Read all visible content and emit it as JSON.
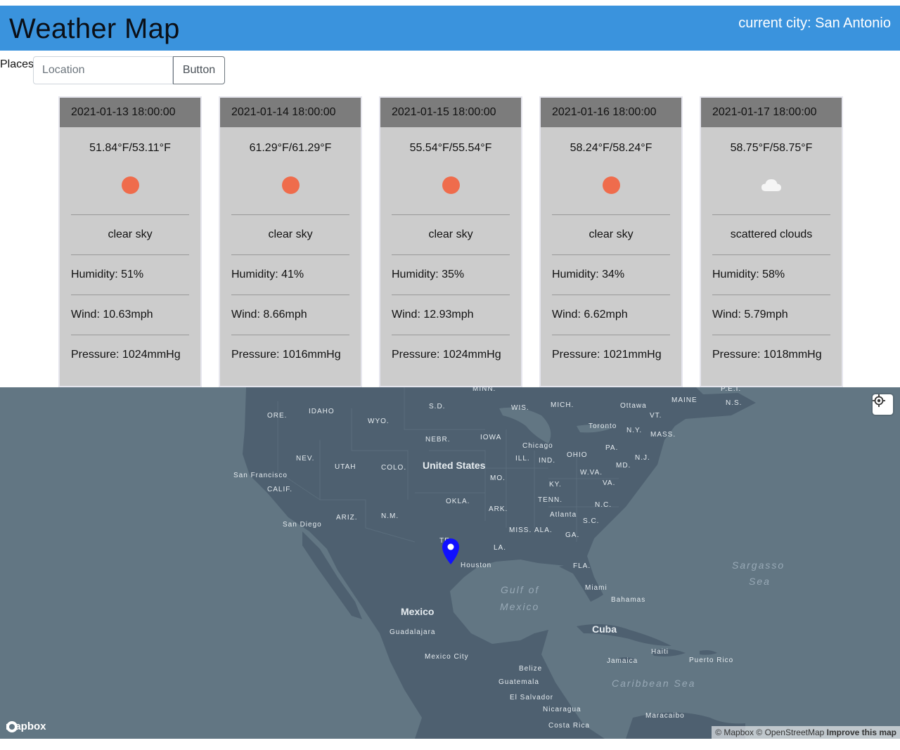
{
  "header": {
    "title": "Weather Map",
    "current_city": "current city: San Antonio"
  },
  "search": {
    "label": "Places",
    "placeholder": "Location",
    "button_label": "Button"
  },
  "forecast": [
    {
      "datetime": "2021-01-13 18:00:00",
      "temps": "51.84°F/53.11°F",
      "icon": "sun-icon",
      "description": "clear sky",
      "humidity": "Humidity: 51%",
      "wind": "Wind: 10.63mph",
      "pressure": "Pressure: 1024mmHg"
    },
    {
      "datetime": "2021-01-14 18:00:00",
      "temps": "61.29°F/61.29°F",
      "icon": "sun-icon",
      "description": "clear sky",
      "humidity": "Humidity: 41%",
      "wind": "Wind: 8.66mph",
      "pressure": "Pressure: 1016mmHg"
    },
    {
      "datetime": "2021-01-15 18:00:00",
      "temps": "55.54°F/55.54°F",
      "icon": "sun-icon",
      "description": "clear sky",
      "humidity": "Humidity: 35%",
      "wind": "Wind: 12.93mph",
      "pressure": "Pressure: 1024mmHg"
    },
    {
      "datetime": "2021-01-16 18:00:00",
      "temps": "58.24°F/58.24°F",
      "icon": "sun-icon",
      "description": "clear sky",
      "humidity": "Humidity: 34%",
      "wind": "Wind: 6.62mph",
      "pressure": "Pressure: 1021mmHg"
    },
    {
      "datetime": "2021-01-17 18:00:00",
      "temps": "58.75°F/58.75°F",
      "icon": "cloud-icon",
      "description": "scattered clouds",
      "humidity": "Humidity: 58%",
      "wind": "Wind: 5.79mph",
      "pressure": "Pressure: 1018mmHg"
    }
  ],
  "map": {
    "labels": {
      "us": "United States",
      "mexico": "Mexico",
      "cuba": "Cuba",
      "gulf": "Gulf of",
      "gulf2": "Mexico",
      "sargasso": "Sargasso",
      "sargasso2": "Sea",
      "caribbean": "Caribbean Sea",
      "houston": "Houston",
      "chicago": "Chicago",
      "atlanta": "Atlanta",
      "miami": "Miami",
      "toronto": "Toronto",
      "ottawa": "Ottawa",
      "sanfrancisco": "San Francisco",
      "sandiego": "San Diego",
      "guadalajara": "Guadalajara",
      "mexicocity": "Mexico City",
      "bahamas": "Bahamas",
      "jamaica": "Jamaica",
      "haiti": "Haiti",
      "puertorico": "Puerto Rico",
      "belize": "Belize",
      "guatemala": "Guatemala",
      "elsalvador": "El Salvador",
      "nicaragua": "Nicaragua",
      "costarica": "Costa Rica",
      "maracaibo": "Maracaibo",
      "ore": "ORE.",
      "idaho": "IDAHO",
      "wyo": "WYO.",
      "sd": "S.D.",
      "minn": "MINN.",
      "wis": "WIS.",
      "mich": "MICH.",
      "nebr": "NEBR.",
      "iowa": "IOWA",
      "ill": "ILL.",
      "ind": "IND.",
      "ohio": "OHIO",
      "pa": "PA.",
      "ny": "N.Y.",
      "vt": "VT.",
      "maine": "MAINE",
      "mass": "MASS.",
      "nj": "N.J.",
      "md": "MD.",
      "nev": "NEV.",
      "utah": "UTAH",
      "colo": "COLO.",
      "calif": "CALIF.",
      "mo": "MO.",
      "ky": "KY.",
      "wva": "W.VA.",
      "va": "VA.",
      "okla": "OKLA.",
      "tenn": "TENN.",
      "nc": "N.C.",
      "ariz": "ARIZ.",
      "nm": "N.M.",
      "ark": "ARK.",
      "sc": "S.C.",
      "miss": "MISS.",
      "ala": "ALA.",
      "ga": "GA.",
      "tx": "TE",
      "la": "LA.",
      "fla": "FLA.",
      "ns": "N.S.",
      "pei": "P.E.I."
    },
    "logo": "mapbox",
    "attribution": {
      "mapbox": "© Mapbox",
      "osm": "© OpenStreetMap",
      "improve": "Improve this map"
    }
  }
}
